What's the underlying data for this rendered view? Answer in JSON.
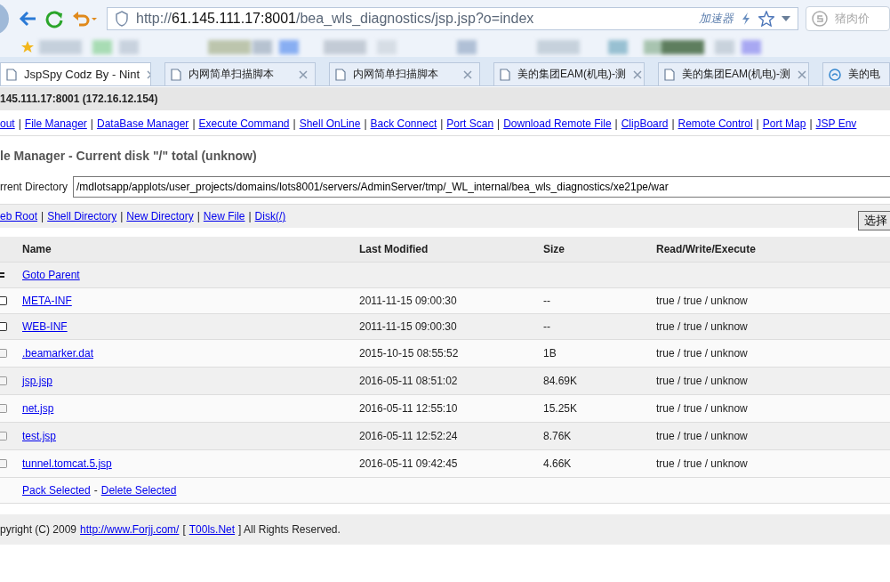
{
  "browser": {
    "address": {
      "scheme": "http://",
      "host": "61.145.111.17:8001",
      "path": "/bea_wls_diagnostics/jsp.jsp?o=index"
    },
    "accelerator": "加速器",
    "search_placeholder": "猪肉价",
    "tabs": [
      {
        "title": "JspSpy Codz By - Nint",
        "selected": true,
        "kind": "page"
      },
      {
        "title": "内网简单扫描脚本",
        "selected": false,
        "kind": "page"
      },
      {
        "title": "内网简单扫描脚本",
        "selected": false,
        "kind": "page"
      },
      {
        "title": "美的集团EAM(机电)-测",
        "selected": false,
        "kind": "page"
      },
      {
        "title": "美的集团EAM(机电)-测",
        "selected": false,
        "kind": "page"
      },
      {
        "title": "美的电",
        "selected": false,
        "kind": "site"
      }
    ]
  },
  "page": {
    "host_line": "145.111.17:8001 (172.16.12.154)",
    "nav_separator": "|",
    "nav": [
      "out",
      "File Manager",
      "DataBase Manager",
      "Execute Command",
      "Shell OnLine",
      "Back Connect",
      "Port Scan",
      "Download Remote File",
      "ClipBoard",
      "Remote Control",
      "Port Map",
      "JSP Env"
    ],
    "heading": "le Manager - Current disk \"/\" total (unknow)",
    "directory": {
      "label": "rrent Directory",
      "value": "/mdlotsapp/applots/user_projects/domains/lots8001/servers/AdminServer/tmp/_WL_internal/bea_wls_diagnostics/xe21pe/war"
    },
    "actions": [
      "eb Root",
      "Shell Directory",
      "New Directory",
      "New File",
      "Disk(/)"
    ],
    "select_button": "选择",
    "table": {
      "columns": [
        "Name",
        "Last Modified",
        "Size",
        "Read/Write/Execute"
      ],
      "parent_link": "Goto Parent",
      "rows": [
        {
          "kind": "dir",
          "checked": false,
          "name": "META-INF",
          "modified": "2011-11-15 09:00:30",
          "size": "--",
          "rwe": "true / true / unknow"
        },
        {
          "kind": "dir",
          "checked": false,
          "name": "WEB-INF",
          "modified": "2011-11-15 09:00:30",
          "size": "--",
          "rwe": "true / true / unknow"
        },
        {
          "kind": "file",
          "checked": false,
          "name": ".beamarker.dat",
          "modified": "2015-10-15 08:55:52",
          "size": "1B",
          "rwe": "true / true / unknow"
        },
        {
          "kind": "file",
          "checked": false,
          "name": "jsp.jsp",
          "modified": "2016-05-11 08:51:02",
          "size": "84.69K",
          "rwe": "true / true / unknow"
        },
        {
          "kind": "file",
          "checked": false,
          "name": "net.jsp",
          "modified": "2016-05-11 12:55:10",
          "size": "15.25K",
          "rwe": "true / true / unknow"
        },
        {
          "kind": "file",
          "checked": false,
          "name": "test.jsp",
          "modified": "2016-05-11 12:52:24",
          "size": "8.76K",
          "rwe": "true / true / unknow"
        },
        {
          "kind": "file",
          "checked": false,
          "name": "tunnel.tomcat.5.jsp",
          "modified": "2016-05-11 09:42:45",
          "size": "4.66K",
          "rwe": "true / true / unknow"
        }
      ],
      "bulk_actions": [
        "Pack Selected",
        "Delete Selected"
      ],
      "bulk_separator": "-"
    },
    "footer": [
      {
        "text": "pyright (C) 2009",
        "link": false
      },
      {
        "text": "http://www.Forjj.com/",
        "link": true
      },
      {
        "text": "[",
        "link": false
      },
      {
        "text": "T00ls.Net",
        "link": true
      },
      {
        "text": "] All Rights Reserved.",
        "link": false
      }
    ]
  }
}
